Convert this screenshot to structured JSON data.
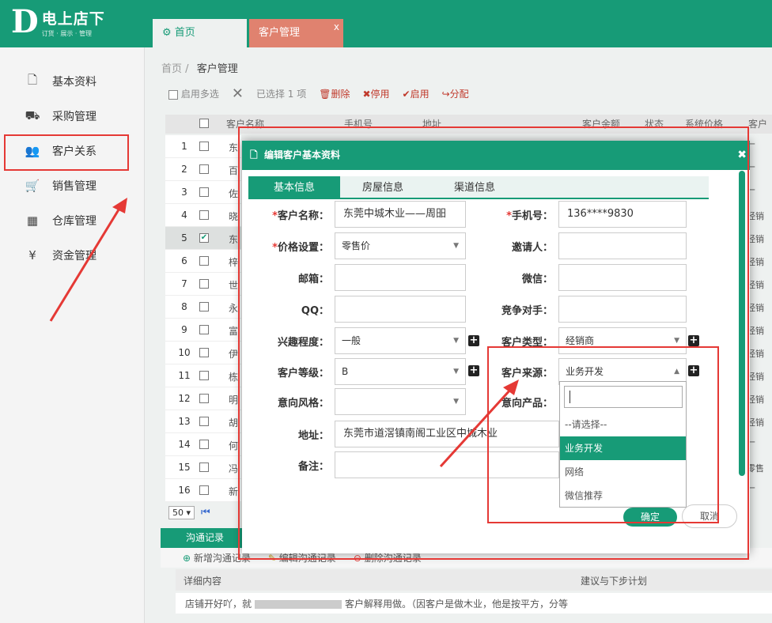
{
  "brand": {
    "letter": "D",
    "name": "电上店下",
    "tagline": "订货 · 展示 · 管理"
  },
  "tabs": [
    {
      "label": "首页",
      "icon": "settings-icon"
    },
    {
      "label": "客户管理",
      "close": "x"
    }
  ],
  "sidebar": {
    "items": [
      {
        "label": "基本资料",
        "icon": "document-icon"
      },
      {
        "label": "采购管理",
        "icon": "truck-icon"
      },
      {
        "label": "客户关系",
        "icon": "users-icon"
      },
      {
        "label": "销售管理",
        "icon": "cart-icon"
      },
      {
        "label": "仓库管理",
        "icon": "building-icon"
      },
      {
        "label": "资金管理",
        "icon": "yen-icon"
      }
    ]
  },
  "breadcrumb": {
    "home": "首页",
    "sep": "/",
    "current": "客户管理"
  },
  "toolbar": {
    "multi": "启用多选",
    "selected": "已选择 1 项",
    "delete": "删除",
    "disable": "停用",
    "enable": "启用",
    "assign": "分配"
  },
  "grid": {
    "headers": [
      "客户名称",
      "手机号",
      "地址",
      "客户余额",
      "状态",
      "系统价格",
      "客户"
    ],
    "rows": [
      {
        "n": "1",
        "frag": "东",
        "right": "厂"
      },
      {
        "n": "2",
        "frag": "百",
        "right": "厂"
      },
      {
        "n": "3",
        "frag": "佐",
        "right": "厂"
      },
      {
        "n": "4",
        "frag": "晓",
        "right": "经销"
      },
      {
        "n": "5",
        "frag": "东",
        "right": "经销",
        "checked": true
      },
      {
        "n": "6",
        "frag": "梓",
        "right": "经销"
      },
      {
        "n": "7",
        "frag": "世",
        "right": "经销"
      },
      {
        "n": "8",
        "frag": "永",
        "right": "经销"
      },
      {
        "n": "9",
        "frag": "富",
        "right": "经销"
      },
      {
        "n": "10",
        "frag": "伊",
        "right": "经销"
      },
      {
        "n": "11",
        "frag": "栋",
        "right": "经销"
      },
      {
        "n": "12",
        "frag": "明",
        "right": "经销"
      },
      {
        "n": "13",
        "frag": "胡",
        "right": "经销"
      },
      {
        "n": "14",
        "frag": "何",
        "right": "厂"
      },
      {
        "n": "15",
        "frag": "冯",
        "right": "零售"
      },
      {
        "n": "16",
        "frag": "新",
        "right": "厂"
      }
    ],
    "page_size": "50"
  },
  "comm": {
    "tab": "沟通记录",
    "add": "新增沟通记录",
    "edit": "编辑沟通记录",
    "del": "删除沟通记录",
    "col1": "详细内容",
    "col2": "建议与下步计划",
    "row_a": "店铺开好吖，就",
    "row_b": "客户解释用做。（因客户是做木业，他是按平方，分等"
  },
  "modal": {
    "title": "编辑客户基本资料",
    "tabs": [
      "基本信息",
      "房屋信息",
      "渠道信息"
    ],
    "fields": {
      "name_label": "客户名称：",
      "name_value": "东莞中城木业——周昍",
      "phone_label": "手机号：",
      "phone_value": "136****9830",
      "price_label": "价格设置：",
      "price_value": "零售价",
      "inviter_label": "邀请人：",
      "email_label": "邮箱：",
      "wechat_label": "微信：",
      "qq_label": "QQ：",
      "rival_label": "竞争对手：",
      "interest_label": "兴趣程度：",
      "interest_value": "一般",
      "ctype_label": "客户类型：",
      "ctype_value": "经销商",
      "level_label": "客户等级：",
      "level_value": "B",
      "source_label": "客户来源：",
      "source_value": "业务开发",
      "style_label": "意向风格：",
      "product_label": "意向产品：",
      "addr_label": "地址：",
      "addr_value": "东莞市道滘镇南阁工业区中城木业",
      "note_label": "备注："
    },
    "dropdown": {
      "options": [
        "--请选择--",
        "业务开发",
        "网络",
        "微信推荐"
      ],
      "active": "业务开发"
    },
    "ok": "确定",
    "cancel": "取消"
  },
  "colors": {
    "brand": "#179b77",
    "annotation": "#e53935"
  }
}
